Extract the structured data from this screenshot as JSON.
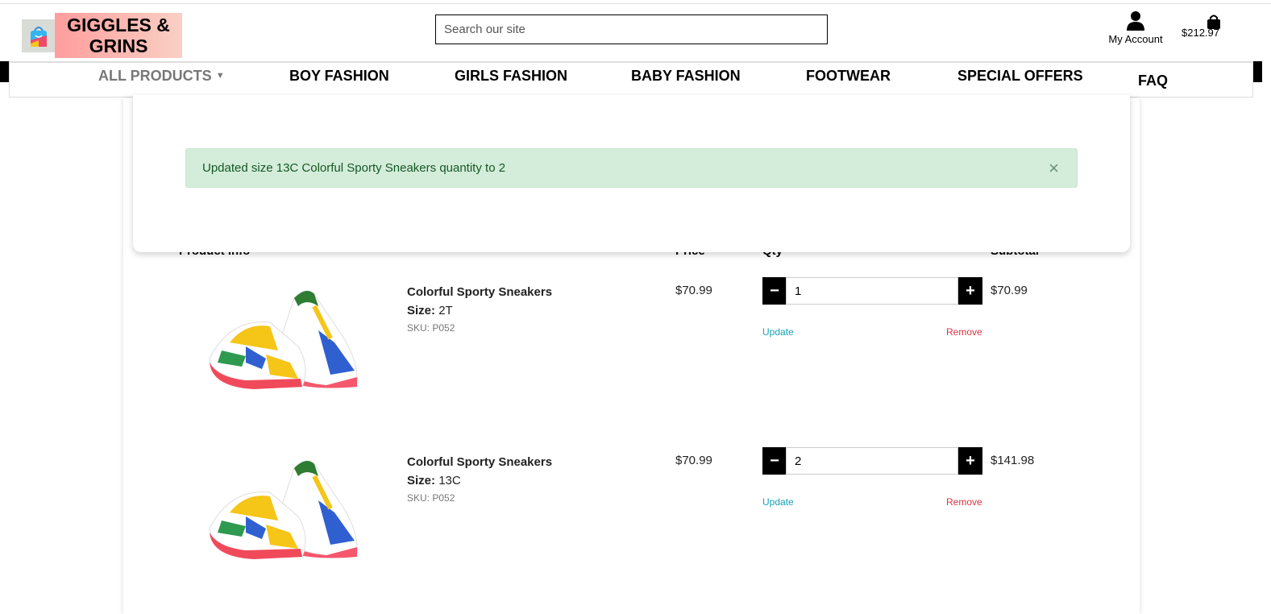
{
  "header": {
    "logo_text": "GIGGLES & GRINS",
    "search_placeholder": "Search our site",
    "account_label": "My Account",
    "cart_total": "$212.97"
  },
  "nav": {
    "items": [
      "ALL PRODUCTS",
      "BOY FASHION",
      "GIRLS FASHION",
      "BABY FASHION",
      "FOOTWEAR",
      "SPECIAL OFFERS",
      "FAQ"
    ]
  },
  "toast": {
    "message": "Updated size 13C Colorful Sporty Sneakers quantity to 2",
    "close": "×"
  },
  "cart": {
    "headers": {
      "product": "Product Info",
      "price": "Price",
      "qty": "Qty",
      "subtotal": "Subtotal"
    },
    "size_label": "Size:",
    "update_label": "Update",
    "remove_label": "Remove",
    "items": [
      {
        "name": "Colorful Sporty Sneakers",
        "size": "2T",
        "sku": "SKU: P052",
        "price": "$70.99",
        "qty": "1",
        "subtotal": "$70.99"
      },
      {
        "name": "Colorful Sporty Sneakers",
        "size": "13C",
        "sku": "SKU: P052",
        "price": "$70.99",
        "qty": "2",
        "subtotal": "$141.98"
      }
    ]
  },
  "colors": {
    "alert_bg": "#d4edda",
    "alert_text": "#155724",
    "update": "#17a2b8",
    "remove": "#dc3545"
  }
}
